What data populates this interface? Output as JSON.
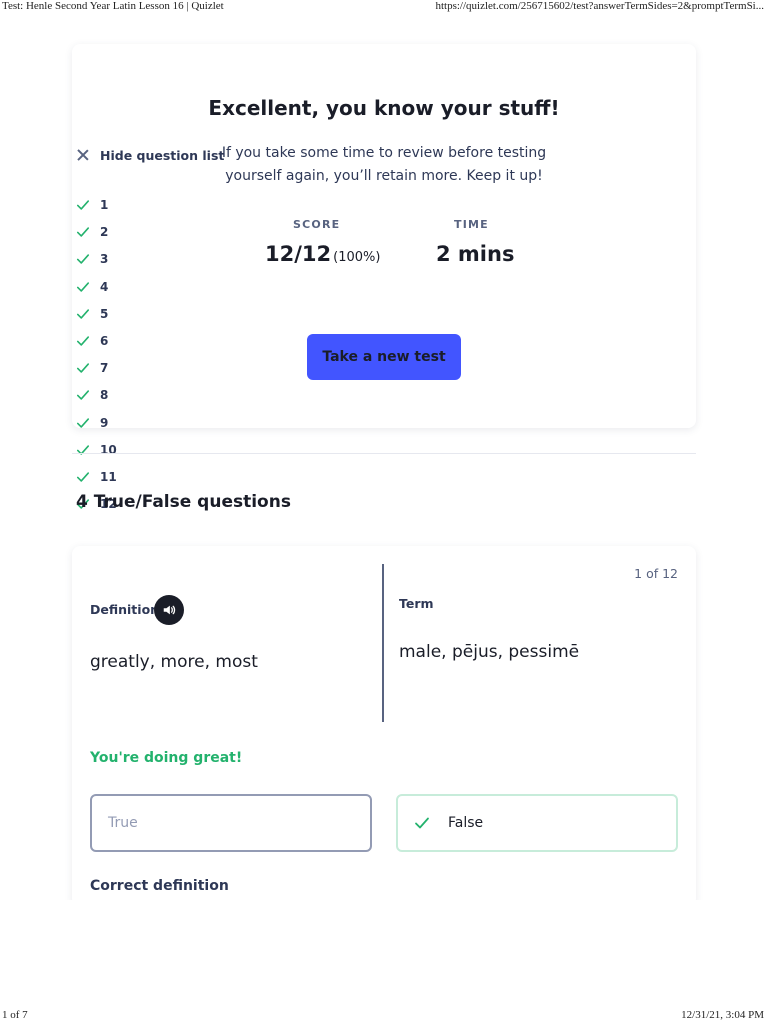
{
  "print_header": {
    "title": "Test: Henle Second Year Latin Lesson 16 | Quizlet",
    "url": "https://quizlet.com/256715602/test?answerTermSides=2&promptTermSi..."
  },
  "print_footer": {
    "page": "1 of 7",
    "datetime": "12/31/21, 3:04 PM"
  },
  "results": {
    "headline": "Excellent, you know your stuff!",
    "subtext": "If you take some time to review before testing yourself again, you’ll retain more. Keep it up!",
    "score_label": "SCORE",
    "score_value": "12/12",
    "score_percent": "(100%)",
    "time_label": "TIME",
    "time_value": "2 mins",
    "new_test_label": "Take a new test"
  },
  "question_list": {
    "toggle_label": "Hide question list",
    "items": [
      "1",
      "2",
      "3",
      "4",
      "5",
      "6",
      "7",
      "8",
      "9",
      "10",
      "11",
      "12"
    ]
  },
  "section": {
    "title": "4 True/False questions"
  },
  "question": {
    "counter": "1 of 12",
    "definition_label": "Definition",
    "definition_text": "greatly, more, most",
    "term_label": "Term",
    "term_text": "male, pējus, pessimē",
    "feedback": "You're doing great!",
    "option_true": "True",
    "option_false": "False",
    "correct_label": "Correct definition"
  },
  "colors": {
    "accent": "#4255ff",
    "success": "#23b26d",
    "text_dark": "#1a1d28",
    "text_muted": "#586380"
  }
}
